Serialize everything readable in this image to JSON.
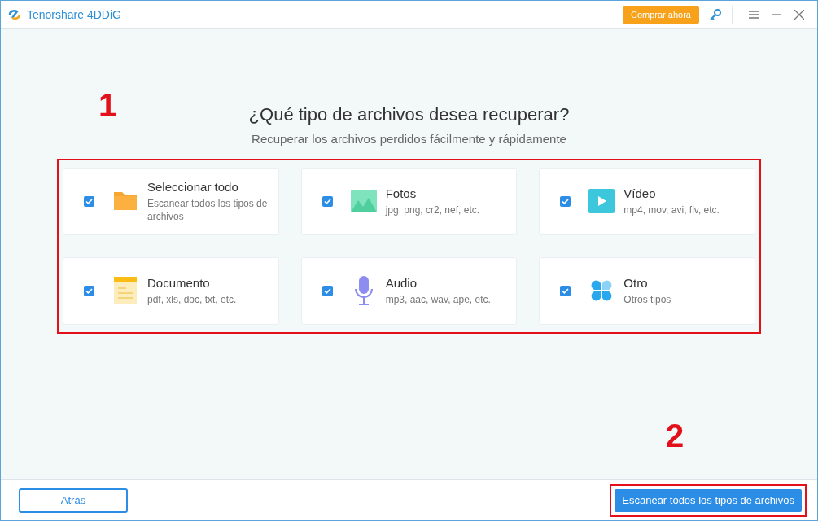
{
  "window": {
    "title": "Tenorshare 4DDiG",
    "buy_button": "Comprar ahora"
  },
  "heading": "¿Qué tipo de archivos desea recuperar?",
  "subheading": "Recuperar los archivos perdidos fácilmente y rápidamente",
  "file_types": [
    {
      "kind": "folder",
      "title": "Seleccionar todo",
      "description": "Escanear todos los tipos de archivos",
      "checked": true
    },
    {
      "kind": "photo",
      "title": "Fotos",
      "description": "jpg, png, cr2, nef, etc.",
      "checked": true
    },
    {
      "kind": "video",
      "title": "Vídeo",
      "description": "mp4, mov, avi, flv, etc.",
      "checked": true
    },
    {
      "kind": "document",
      "title": "Documento",
      "description": "pdf, xls, doc, txt, etc.",
      "checked": true
    },
    {
      "kind": "audio",
      "title": "Audio",
      "description": "mp3, aac, wav, ape, etc.",
      "checked": true
    },
    {
      "kind": "other",
      "title": "Otro",
      "description": "Otros tipos",
      "checked": true
    }
  ],
  "footer": {
    "back_button": "Atrás",
    "scan_button": "Escanear todos los tipos de archivos"
  },
  "annotations": [
    {
      "label": "1"
    },
    {
      "label": "2"
    }
  ]
}
